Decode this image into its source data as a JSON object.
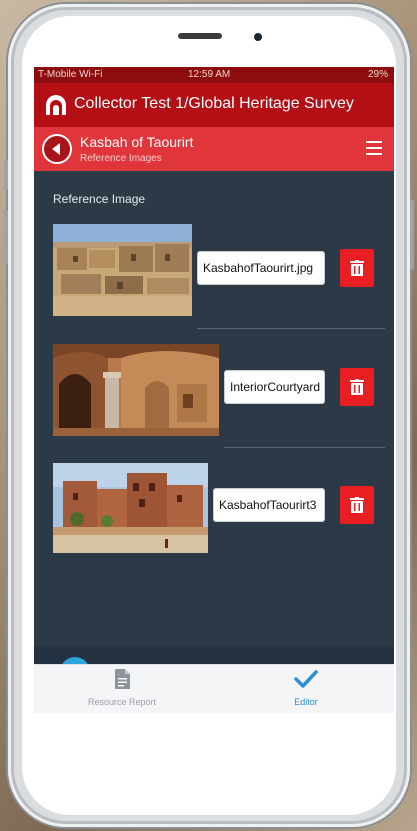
{
  "status_bar": {
    "carrier": "T-Mobile Wi-Fi",
    "time": "12:59 AM",
    "battery": "29%"
  },
  "app_bar": {
    "title": "Collector Test 1/Global Heritage Survey",
    "logo_icon": "arch-logo-icon"
  },
  "sub_bar": {
    "title": "Kasbah of Taourirt",
    "subtitle": "Reference Images",
    "back_icon": "back-arrow-icon",
    "menu_icon": "hamburger-menu-icon"
  },
  "content": {
    "section_label": "Reference Image",
    "images": [
      {
        "filename": "KasbahofTaourirt.jpg",
        "description_icon": "kasbah-ruins-photo"
      },
      {
        "filename": "InteriorCourtyard",
        "description_icon": "interior-courtyard-photo"
      },
      {
        "filename": "KasbahofTaourirt3",
        "description_icon": "kasbah-exterior-photo"
      }
    ],
    "delete_icon": "trash-icon"
  },
  "tab_bar": {
    "tabs": [
      {
        "label": "Resource Report",
        "icon": "document-icon"
      },
      {
        "label": "Editor",
        "icon": "checkmark-icon"
      }
    ]
  },
  "colors": {
    "status_bar": "#8c0d0d",
    "app_bar": "#b30f14",
    "sub_bar": "#e0353a",
    "content_bg": "#2c3a48",
    "delete_button": "#e81e22",
    "editor_active": "#2c8fd6"
  }
}
